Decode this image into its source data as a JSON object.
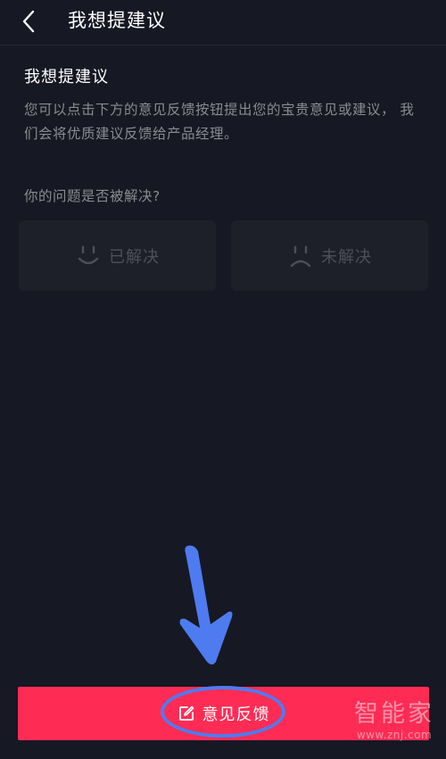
{
  "topbar": {
    "back_icon": "chevron-left-icon",
    "title": "我想提建议"
  },
  "main": {
    "section_title": "我想提建议",
    "description": "您可以点击下方的意见反馈按钮提出您的宝贵意见或建议， 我们会将优质建议反馈给产品经理。",
    "question": "你的问题是否被解决?",
    "choices": [
      {
        "label": "已解决",
        "icon": "smile-face-icon"
      },
      {
        "label": "未解决",
        "icon": "sad-face-icon"
      }
    ]
  },
  "feedback_button": {
    "label": "意见反馈",
    "icon": "edit-icon",
    "color": "#fe2c55"
  },
  "watermark": {
    "title": "智能家",
    "url": "www.znj.com"
  },
  "colors": {
    "background": "#161823",
    "card": "#1e2029",
    "annotation": "#4e7bf0"
  }
}
